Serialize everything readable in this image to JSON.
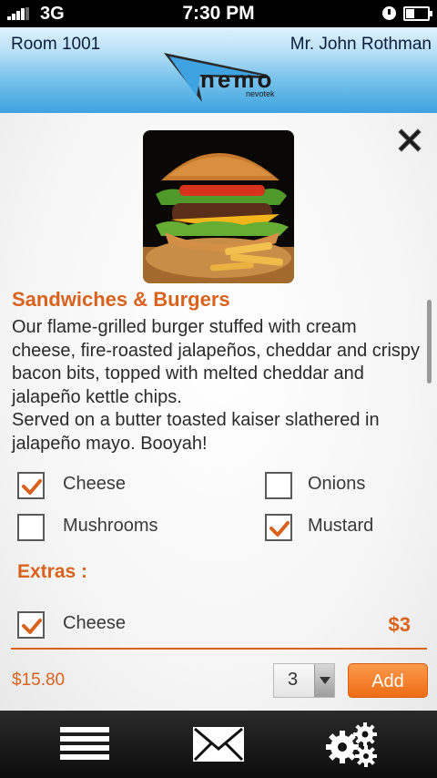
{
  "status_bar": {
    "network": "3G",
    "time": "7:30 PM"
  },
  "header": {
    "room": "Room  1001",
    "guest": "Mr. John Rothman",
    "logo_text": "nemo",
    "logo_subtext": "nevotek"
  },
  "item": {
    "title": "Sandwiches & Burgers",
    "description_lines": [
      "Our flame-grilled burger stuffed with cream cheese, fire-roasted jalapeños, cheddar and crispy bacon bits, topped with melted cheddar and jalapeño kettle chips.",
      "Served on a butter toasted kaiser slathered in jalapeño mayo. Booyah!"
    ]
  },
  "options": [
    {
      "label": "Cheese",
      "checked": true
    },
    {
      "label": "Onions",
      "checked": false
    },
    {
      "label": "Mushrooms",
      "checked": false
    },
    {
      "label": "Mustard",
      "checked": true
    }
  ],
  "extras": {
    "title": "Extras :",
    "items": [
      {
        "label": "Cheese",
        "price": "$3",
        "checked": true
      }
    ]
  },
  "order": {
    "total": "$15.80",
    "quantity": "3",
    "add_label": "Add"
  },
  "colors": {
    "accent": "#d9631e",
    "header_blue": "#3ea3e0",
    "button_orange": "#ee6d15"
  },
  "icons": {
    "close": "close-icon",
    "menu": "menu-icon",
    "message": "envelope-icon",
    "settings": "gears-icon"
  }
}
